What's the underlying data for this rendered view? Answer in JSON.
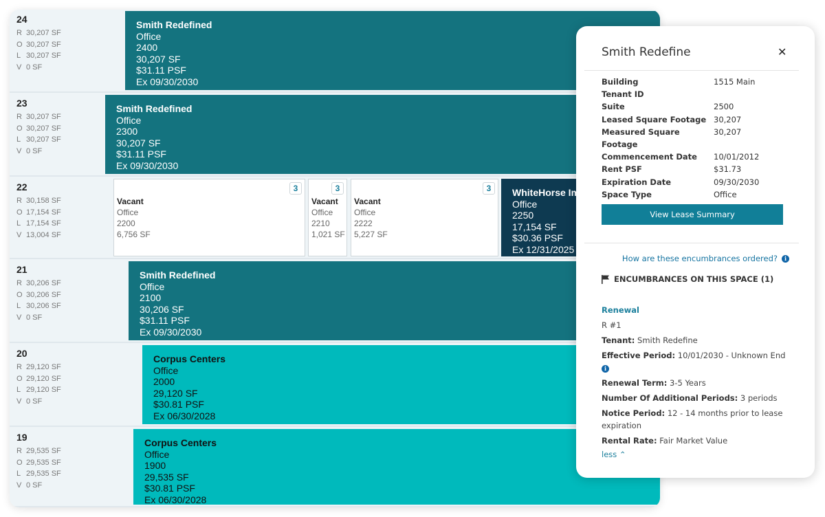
{
  "colors": {
    "leased_dark": "#14737f",
    "leased_light": "#00babc",
    "leased_navy": "#0e3a51",
    "vacant": "#ffffff",
    "accent": "#117f98"
  },
  "floors": [
    {
      "floor": "24",
      "stats": [
        [
          "R",
          "30,207 SF"
        ],
        [
          "O",
          "30,207 SF"
        ],
        [
          "L",
          "30,207 SF"
        ],
        [
          "V",
          "0 SF"
        ]
      ],
      "spaces": [
        {
          "type": "teal",
          "lines": [
            "Smith Redefined",
            "Office",
            "2400",
            "30,207 SF",
            "$31.11 PSF",
            "Ex 09/30/2030"
          ]
        }
      ]
    },
    {
      "floor": "23",
      "stats": [
        [
          "R",
          "30,207 SF"
        ],
        [
          "O",
          "30,207 SF"
        ],
        [
          "L",
          "30,207 SF"
        ],
        [
          "V",
          "0 SF"
        ]
      ],
      "spaces": [
        {
          "type": "teal",
          "lines": [
            "Smith Redefined",
            "Office",
            "2300",
            "30,207 SF",
            "$31.11 PSF",
            "Ex 09/30/2030"
          ]
        }
      ]
    },
    {
      "floor": "22",
      "stats": [
        [
          "R",
          "30,158 SF"
        ],
        [
          "O",
          "17,154 SF"
        ],
        [
          "L",
          "17,154 SF"
        ],
        [
          "V",
          "13,004 SF"
        ]
      ],
      "spaces": [
        {
          "type": "vacant",
          "badge": "3",
          "lines": [
            "Vacant",
            "Office",
            "2200",
            "6,756 SF"
          ]
        },
        {
          "type": "vacant",
          "badge": "3",
          "lines": [
            "Vacant",
            "Office",
            "2210",
            "1,021 SF"
          ]
        },
        {
          "type": "vacant",
          "badge": "3",
          "lines": [
            "Vacant",
            "Office",
            "2222",
            "5,227 SF"
          ]
        },
        {
          "type": "navy",
          "lines": [
            "WhiteHorse Im",
            "Office",
            "2250",
            "17,154 SF",
            "$30.36 PSF",
            "Ex 12/31/2025"
          ]
        }
      ]
    },
    {
      "floor": "21",
      "stats": [
        [
          "R",
          "30,206 SF"
        ],
        [
          "O",
          "30,206 SF"
        ],
        [
          "L",
          "30,206 SF"
        ],
        [
          "V",
          "0 SF"
        ]
      ],
      "spaces": [
        {
          "type": "teal",
          "lines": [
            "Smith Redefined",
            "Office",
            "2100",
            "30,206 SF",
            "$31.11 PSF",
            "Ex 09/30/2030"
          ]
        }
      ]
    },
    {
      "floor": "20",
      "stats": [
        [
          "R",
          "29,120 SF"
        ],
        [
          "O",
          "29,120 SF"
        ],
        [
          "L",
          "29,120 SF"
        ],
        [
          "V",
          "0 SF"
        ]
      ],
      "spaces": [
        {
          "type": "cyan",
          "lines": [
            "Corpus Centers",
            "Office",
            "2000",
            "29,120 SF",
            "$30.81 PSF",
            "Ex 06/30/2028"
          ]
        }
      ]
    },
    {
      "floor": "19",
      "stats": [
        [
          "R",
          "29,535 SF"
        ],
        [
          "O",
          "29,535 SF"
        ],
        [
          "L",
          "29,535 SF"
        ],
        [
          "V",
          "0 SF"
        ]
      ],
      "spaces": [
        {
          "type": "cyan",
          "lines": [
            "Corpus Centers",
            "Office",
            "1900",
            "29,535 SF",
            "$30.81 PSF",
            "Ex 06/30/2028"
          ]
        }
      ]
    }
  ],
  "panel": {
    "title": "Smith Redefine",
    "close_icon": "close-icon",
    "fields": [
      {
        "label": "Building",
        "value": "1515 Main"
      },
      {
        "label": "Tenant ID",
        "value": ""
      },
      {
        "label": "Suite",
        "value": "2500"
      },
      {
        "label": "Leased Square Footage",
        "value": "30,207"
      },
      {
        "label": "Measured Square Footage",
        "value": "30,207"
      },
      {
        "label": "Commencement Date",
        "value": "10/01/2012"
      },
      {
        "label": "Rent PSF",
        "value": "$31.73"
      },
      {
        "label": "Expiration Date",
        "value": "09/30/2030"
      },
      {
        "label": "Space Type",
        "value": "Office"
      }
    ],
    "view_button": "View Lease Summary",
    "how_link": "How are these encumbrances ordered?",
    "enc_heading": "ENCUMBRANCES ON THIS SPACE (1)",
    "encumbrance": {
      "type": "Renewal",
      "id": "R #1",
      "tenant_label": "Tenant:",
      "tenant": "Smith Redefine",
      "period_label": "Effective Period:",
      "period": "10/01/2030 - Unknown End",
      "term_label": "Renewal Term:",
      "term": "3-5 Years",
      "periods_label": "Number Of Additional Periods:",
      "periods": "3 periods",
      "notice_label": "Notice Period:",
      "notice": "12 - 14 months prior to lease expiration",
      "rate_label": "Rental Rate:",
      "rate": "Fair Market Value",
      "less": "less"
    }
  }
}
